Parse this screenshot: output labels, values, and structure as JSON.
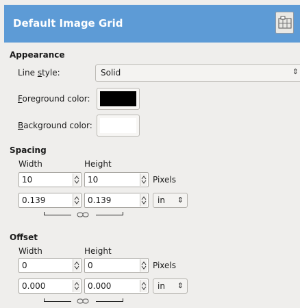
{
  "header": {
    "title": "Default Image Grid",
    "icon": "image-grid-icon"
  },
  "appearance": {
    "title": "Appearance",
    "line_style_label_pre": "Line ",
    "line_style_label_u": "s",
    "line_style_label_post": "tyle:",
    "line_style_value": "Solid",
    "fg_label_u": "F",
    "fg_label_post": "oreground color:",
    "fg_color": "#000000",
    "bg_label_u": "B",
    "bg_label_post": "ackground color:",
    "bg_color": "#ffffff"
  },
  "spacing": {
    "title": "Spacing",
    "width_label": "Width",
    "height_label": "Height",
    "width_px": "10",
    "height_px": "10",
    "px_unit": "Pixels",
    "width_in": "0.139",
    "height_in": "0.139",
    "unit": "in"
  },
  "offset": {
    "title": "Offset",
    "width_label": "Width",
    "height_label": "Height",
    "width_px": "0",
    "height_px": "0",
    "px_unit": "Pixels",
    "width_in": "0.000",
    "height_in": "0.000",
    "unit": "in"
  }
}
